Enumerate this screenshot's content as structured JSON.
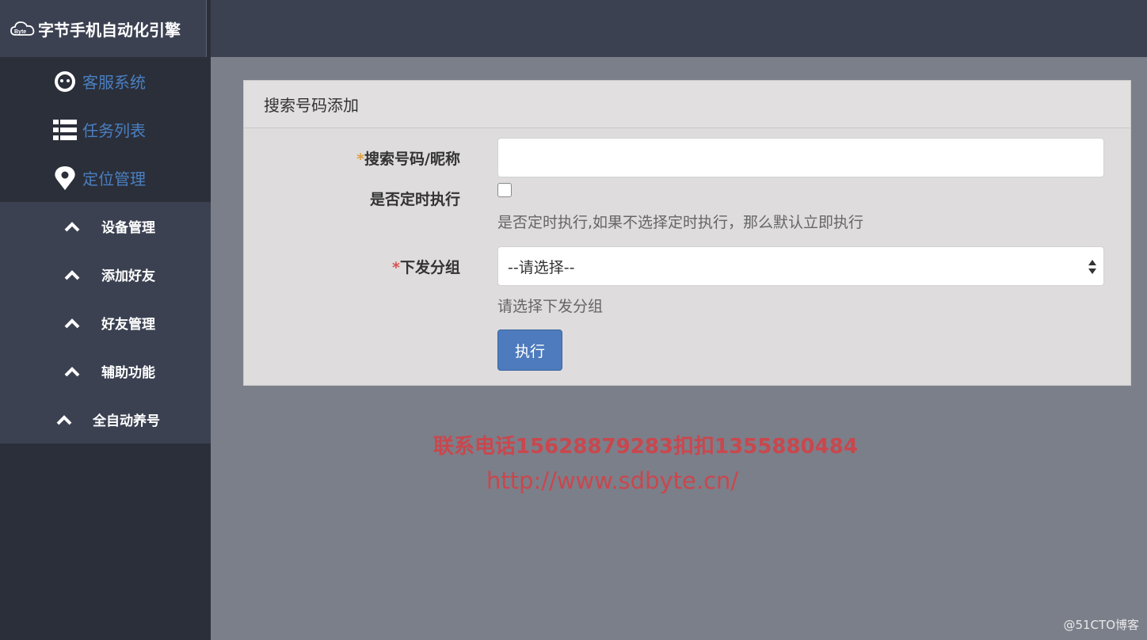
{
  "brand": {
    "title": "字节手机自动化引擎",
    "logo_text": "Byte"
  },
  "sidebar": {
    "main_items": [
      {
        "label": "客服系统",
        "icon": "robot-face-icon"
      },
      {
        "label": "任务列表",
        "icon": "list-icon"
      },
      {
        "label": "定位管理",
        "icon": "location-pin-icon"
      }
    ],
    "sub_items": [
      {
        "label": "设备管理",
        "icon": "chevron-up-icon"
      },
      {
        "label": "添加好友",
        "icon": "chevron-up-icon"
      },
      {
        "label": "好友管理",
        "icon": "chevron-up-icon"
      },
      {
        "label": "辅助功能",
        "icon": "chevron-up-icon"
      },
      {
        "label": "全自动养号",
        "icon": "chevron-up-icon"
      }
    ]
  },
  "panel": {
    "title": "搜索号码添加",
    "fields": {
      "search": {
        "required_mark": "*",
        "label": "搜索号码/昵称",
        "value": ""
      },
      "scheduled": {
        "label": "是否定时执行",
        "checked": false,
        "help": "是否定时执行,如果不选择定时执行，那么默认立即执行"
      },
      "group": {
        "required_mark": "*",
        "label": "下发分组",
        "selected": "--请选择--",
        "help": "请选择下发分组"
      }
    },
    "submit_label": "执行"
  },
  "overlay": {
    "contact": "联系电话15628879283扣扣1355880484",
    "url": "http://www.sdbyte.cn/",
    "watermark": "@51CTO博客"
  },
  "colors": {
    "sidebar_bg": "#2b2f3a",
    "subnav_bg": "#3b4151",
    "nav_accent": "#4a7fc0",
    "button": "#4d7bbd",
    "required_orange": "#e0a040",
    "required_red": "#d9534f",
    "overlay_text": "#c9474d"
  }
}
